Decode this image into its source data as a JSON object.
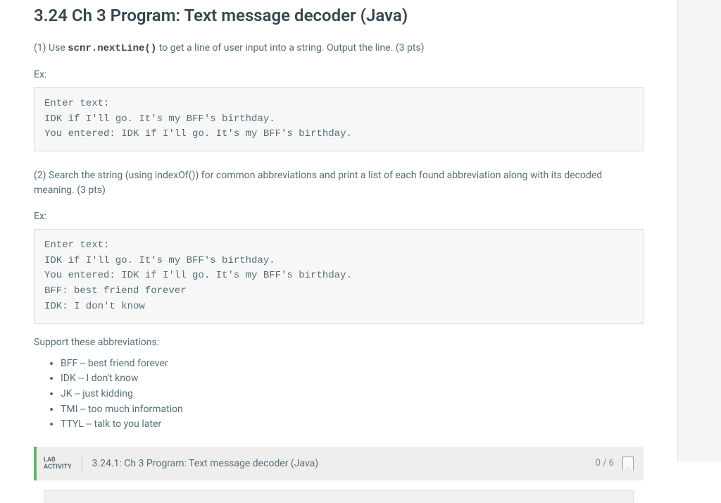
{
  "title": "3.24 Ch 3 Program: Text message decoder (Java)",
  "step1": {
    "prefix": "(1) Use ",
    "code": "scnr.nextLine()",
    "suffix": " to get a line of user input into a string. Output the line. (3 pts)"
  },
  "ex_label": "Ex:",
  "code_block_1": "Enter text:\nIDK if I'll go. It's my BFF's birthday.\nYou entered: IDK if I'll go. It's my BFF's birthday.",
  "step2_text": "(2) Search the string (using indexOf()) for common abbreviations and print a list of each found abbreviation along with its decoded meaning. (3 pts)",
  "code_block_2": "Enter text:\nIDK if I'll go. It's my BFF's birthday.\nYou entered: IDK if I'll go. It's my BFF's birthday.\nBFF: best friend forever\nIDK: I don't know",
  "support_label": "Support these abbreviations:",
  "abbreviations": [
    "BFF -- best friend forever",
    "IDK -- I don't know",
    "JK -- just kidding",
    "TMI -- too much information",
    "TTYL -- talk to you later"
  ],
  "lab": {
    "badge_line1": "LAB",
    "badge_line2": "ACTIVITY",
    "title": "3.24.1: Ch 3 Program: Text message decoder (Java)",
    "score": "0 / 6"
  }
}
